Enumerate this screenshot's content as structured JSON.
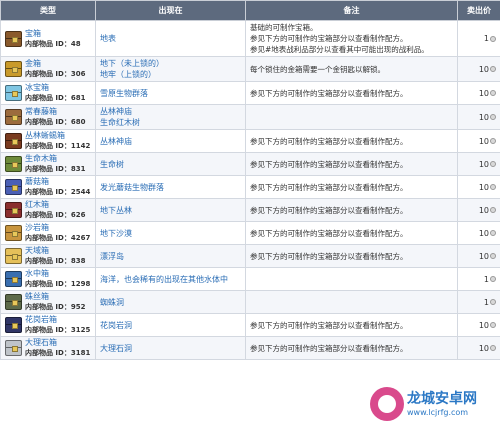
{
  "header": {
    "type": "类型",
    "where": "出现在",
    "note": "备注",
    "price": "卖出价"
  },
  "id_prefix": "内部物品 ID：",
  "rows": [
    {
      "name": "宝箱",
      "id": "48",
      "color": "#8a5a2c",
      "where": [
        "地表"
      ],
      "note": [
        "基础的可制作宝箱。",
        "参见下方的可制作的宝箱部分以查看制作配方。",
        "参见#地表战利品部分以查看其中可能出现的战利品。"
      ],
      "price": "1"
    },
    {
      "name": "金箱",
      "id": "306",
      "color": "#c99a2a",
      "where": [
        "地下（未上锁的）",
        "地牢（上锁的）"
      ],
      "note": [
        "每个锁住的金箱需要一个金钥匙以解锁。"
      ],
      "price": "10"
    },
    {
      "name": "冰宝箱",
      "id": "681",
      "color": "#7fc6e3",
      "where": [
        "雪原生物群落"
      ],
      "note": [
        "参见下方的可制作的宝箱部分以查看制作配方。"
      ],
      "price": "10"
    },
    {
      "name": "常春藤箱",
      "id": "680",
      "color": "#9c6b3d",
      "where": [
        "丛林神庙",
        "生命红木树"
      ],
      "note": [],
      "price": "10"
    },
    {
      "name": "丛林蜥蜴箱",
      "id": "1142",
      "color": "#7a3b1f",
      "where": [
        "丛林神庙"
      ],
      "note": [
        "参见下方的可制作的宝箱部分以查看制作配方。"
      ],
      "price": "10"
    },
    {
      "name": "生命木箱",
      "id": "831",
      "color": "#6d8a3a",
      "where": [
        "生命树"
      ],
      "note": [
        "参见下方的可制作的宝箱部分以查看制作配方。"
      ],
      "price": "10"
    },
    {
      "name": "蘑菇箱",
      "id": "2544",
      "color": "#4a5fb5",
      "where": [
        "发光蘑菇生物群落"
      ],
      "note": [
        "参见下方的可制作的宝箱部分以查看制作配方。"
      ],
      "price": "10"
    },
    {
      "name": "红木箱",
      "id": "626",
      "color": "#8a2e2e",
      "where": [
        "地下丛林"
      ],
      "note": [
        "参见下方的可制作的宝箱部分以查看制作配方。"
      ],
      "price": "10"
    },
    {
      "name": "沙岩箱",
      "id": "4267",
      "color": "#c8953e",
      "where": [
        "地下沙漠"
      ],
      "note": [
        "参见下方的可制作的宝箱部分以查看制作配方。"
      ],
      "price": "10"
    },
    {
      "name": "天域箱",
      "id": "838",
      "color": "#e5c05a",
      "where": [
        "漂浮岛"
      ],
      "note": [
        "参见下方的可制作的宝箱部分以查看制作配方。"
      ],
      "price": "10"
    },
    {
      "name": "水中箱",
      "id": "1298",
      "color": "#3a6fb0",
      "where": [
        "海洋，也会稀有的出现在其他水体中"
      ],
      "note": [],
      "price": "1"
    },
    {
      "name": "蛛丝箱",
      "id": "952",
      "color": "#5d6a4a",
      "where": [
        "蜘蛛洞"
      ],
      "note": [],
      "price": "1"
    },
    {
      "name": "花岗岩箱",
      "id": "3125",
      "color": "#2f3566",
      "where": [
        "花岗岩洞"
      ],
      "note": [
        "参见下方的可制作的宝箱部分以查看制作配方。"
      ],
      "price": "10"
    },
    {
      "name": "大理石箱",
      "id": "3181",
      "color": "#bfc4c9",
      "where": [
        "大理石洞"
      ],
      "note": [
        "参见下方的可制作的宝箱部分以查看制作配方。"
      ],
      "price": "10"
    }
  ],
  "watermark": {
    "title": "龙城安卓网",
    "url": "www.lcjrfg.com"
  }
}
